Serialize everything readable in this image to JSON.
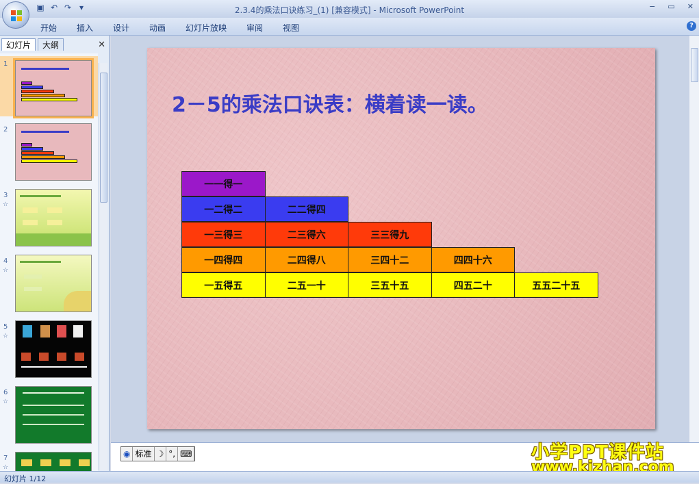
{
  "window": {
    "title": "2.3.4的乘法口诀练习_(1) [兼容模式] - Microsoft PowerPoint",
    "controls": [
      "−",
      "▭",
      "✕"
    ]
  },
  "qat": {
    "save_icon": "save-icon",
    "undo_icon": "undo-icon",
    "redo_icon": "redo-icon",
    "customize_icon": "dropdown-icon"
  },
  "ribbon": {
    "tabs": [
      "开始",
      "插入",
      "设计",
      "动画",
      "幻灯片放映",
      "审阅",
      "视图"
    ],
    "help": "?"
  },
  "panel": {
    "tabs": [
      "幻灯片",
      "大纲"
    ],
    "close": "✕"
  },
  "thumbnails": [
    {
      "num": "1",
      "star": ""
    },
    {
      "num": "2",
      "star": ""
    },
    {
      "num": "3",
      "star": "☆"
    },
    {
      "num": "4",
      "star": "☆"
    },
    {
      "num": "5",
      "star": "☆"
    },
    {
      "num": "6",
      "star": "☆"
    },
    {
      "num": "7",
      "star": "☆"
    }
  ],
  "slide": {
    "title": "2－5的乘法口诀表：横着读一读。",
    "title_color": "#3a3cc6",
    "rows": [
      {
        "color": "#9b18c9",
        "cells": [
          "一一得一"
        ]
      },
      {
        "color": "#3a3cf0",
        "cells": [
          "一二得二",
          "二二得四"
        ]
      },
      {
        "color": "#ff3a0a",
        "cells": [
          "一三得三",
          "二三得六",
          "三三得九"
        ]
      },
      {
        "color": "#ff9a00",
        "cells": [
          "一四得四",
          "二四得八",
          "三四十二",
          "四四十六"
        ]
      },
      {
        "color": "#ffff00",
        "cells": [
          "一五得五",
          "二五一十",
          "三五十五",
          "四五二十",
          "五五二十五"
        ]
      }
    ]
  },
  "ime": {
    "mode": "标准",
    "icons": [
      "ime-logo-icon",
      "moon-icon",
      "punctuation-icon",
      "keyboard-icon"
    ]
  },
  "watermark": {
    "line1": "小学PPT课件站",
    "line2": "www.kjzhan.com"
  },
  "status": {
    "text": "幻灯片 1/12"
  }
}
